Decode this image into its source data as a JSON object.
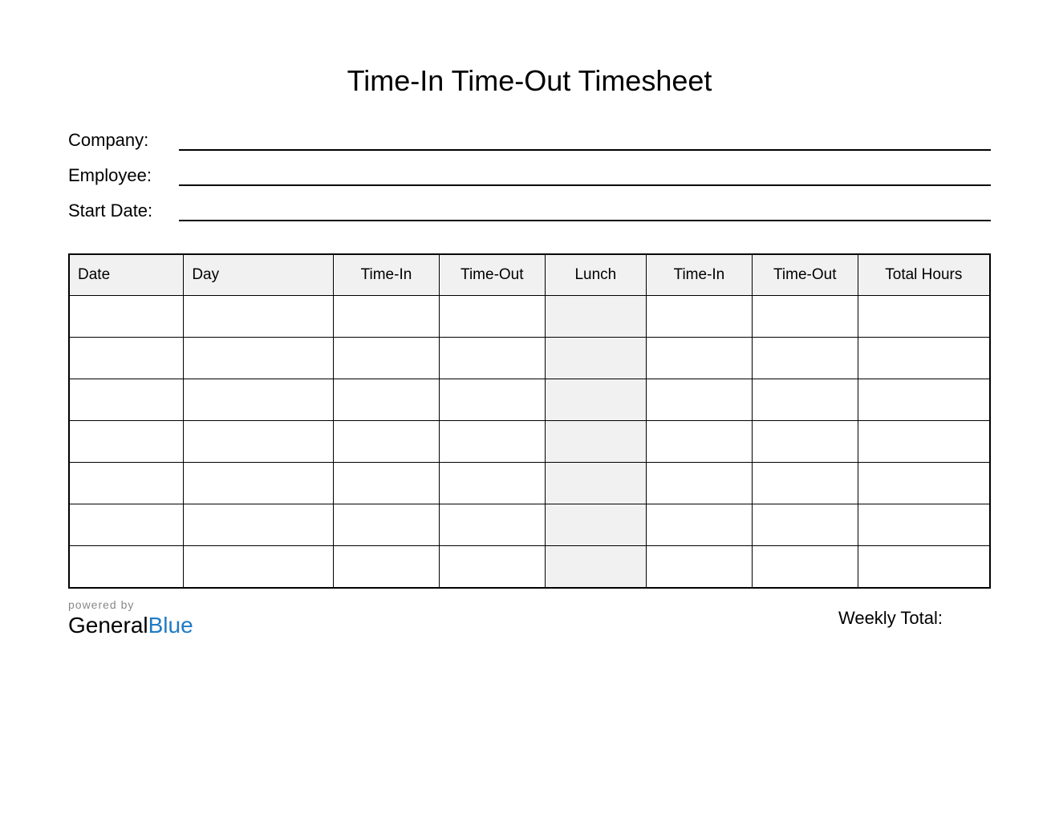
{
  "title": "Time-In Time-Out Timesheet",
  "info": {
    "company_label": "Company:",
    "company_value": "",
    "employee_label": "Employee:",
    "employee_value": "",
    "start_date_label": "Start Date:",
    "start_date_value": ""
  },
  "table": {
    "headers": {
      "date": "Date",
      "day": "Day",
      "time_in_1": "Time-In",
      "time_out_1": "Time-Out",
      "lunch": "Lunch",
      "time_in_2": "Time-In",
      "time_out_2": "Time-Out",
      "total_hours": "Total Hours"
    },
    "rows": [
      {
        "date": "",
        "day": "",
        "time_in_1": "",
        "time_out_1": "",
        "lunch": "",
        "time_in_2": "",
        "time_out_2": "",
        "total_hours": ""
      },
      {
        "date": "",
        "day": "",
        "time_in_1": "",
        "time_out_1": "",
        "lunch": "",
        "time_in_2": "",
        "time_out_2": "",
        "total_hours": ""
      },
      {
        "date": "",
        "day": "",
        "time_in_1": "",
        "time_out_1": "",
        "lunch": "",
        "time_in_2": "",
        "time_out_2": "",
        "total_hours": ""
      },
      {
        "date": "",
        "day": "",
        "time_in_1": "",
        "time_out_1": "",
        "lunch": "",
        "time_in_2": "",
        "time_out_2": "",
        "total_hours": ""
      },
      {
        "date": "",
        "day": "",
        "time_in_1": "",
        "time_out_1": "",
        "lunch": "",
        "time_in_2": "",
        "time_out_2": "",
        "total_hours": ""
      },
      {
        "date": "",
        "day": "",
        "time_in_1": "",
        "time_out_1": "",
        "lunch": "",
        "time_in_2": "",
        "time_out_2": "",
        "total_hours": ""
      },
      {
        "date": "",
        "day": "",
        "time_in_1": "",
        "time_out_1": "",
        "lunch": "",
        "time_in_2": "",
        "time_out_2": "",
        "total_hours": ""
      }
    ]
  },
  "footer": {
    "powered_by": "powered by",
    "logo_general": "General",
    "logo_blue": "Blue",
    "weekly_total_label": "Weekly Total:",
    "weekly_total_value": ""
  }
}
